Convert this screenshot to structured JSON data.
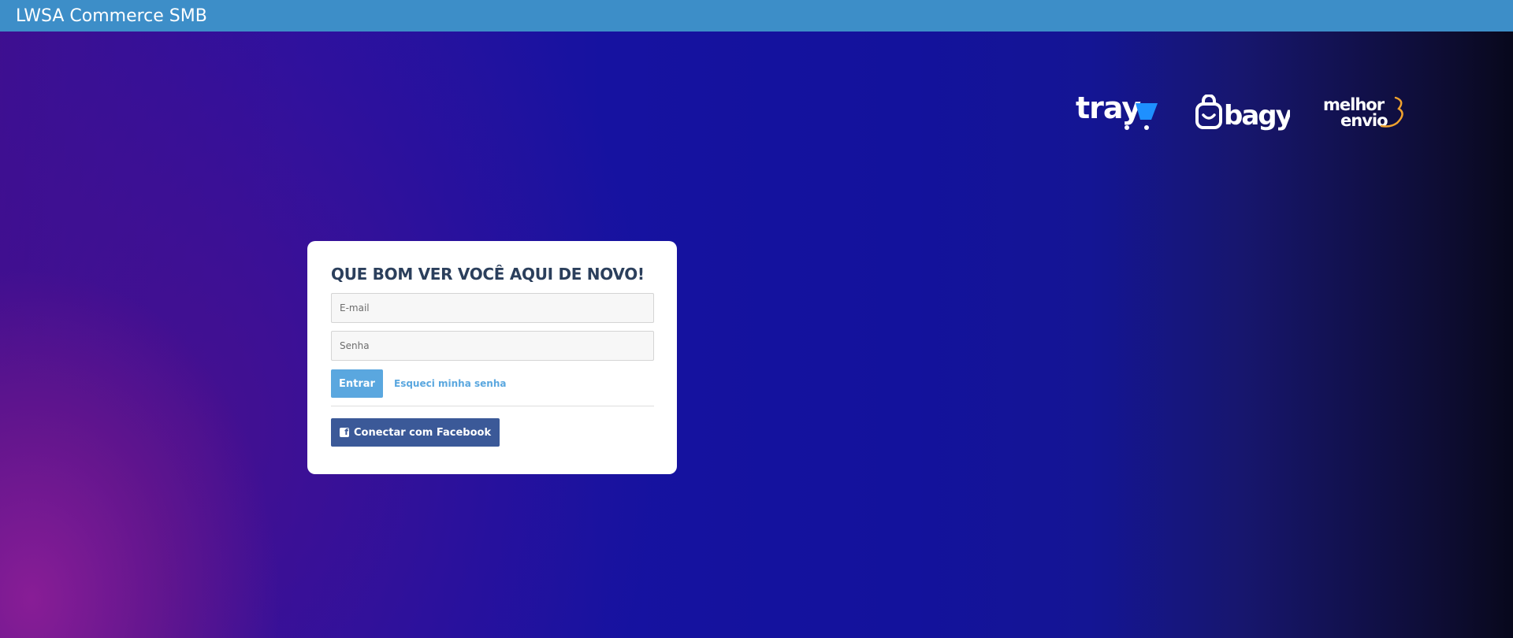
{
  "topbar": {
    "title": "LWSA Commerce SMB"
  },
  "logos": [
    {
      "name": "tray",
      "text": "tray",
      "accent": "#1e90ff"
    },
    {
      "name": "bagy",
      "text": "bagy"
    },
    {
      "name": "melhor-envio",
      "text_top": "melhor",
      "text_bottom": "envio",
      "accent": "#f0a22e"
    }
  ],
  "login": {
    "title": "QUE BOM VER VOCÊ AQUI DE NOVO!",
    "email_placeholder": "E-mail",
    "password_placeholder": "Senha",
    "submit_label": "Entrar",
    "forgot_label": "Esqueci minha senha",
    "facebook_label": "Conectar com Facebook",
    "facebook_icon_glyph": "f"
  },
  "colors": {
    "topbar": "#3d8ec8",
    "primary_button": "#5aa7df",
    "facebook": "#3b5998",
    "title_text": "#2b3f5c"
  }
}
